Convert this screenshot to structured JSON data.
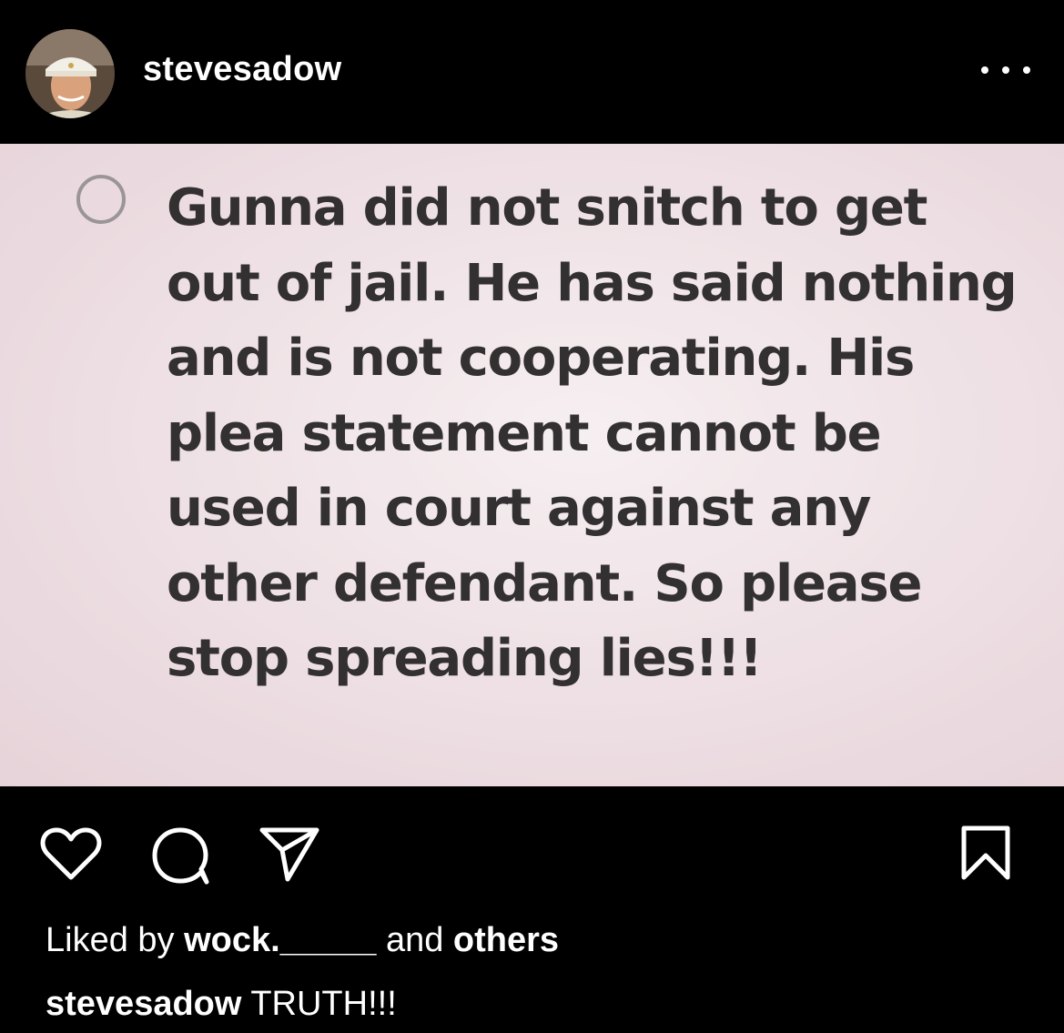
{
  "header": {
    "username": "stevesadow",
    "avatar_icon": "profile-photo",
    "more_icon": "more-horizontal-icon"
  },
  "post": {
    "note_lines": [
      "Gunna did not snitch to get",
      "out of jail. He has said nothing",
      "and is not cooperating. His",
      "plea statement cannot be",
      "used in court against any",
      "other defendant. So please",
      "stop spreading lies!!!"
    ],
    "background_color": "#efe2e6",
    "text_color": "#333032"
  },
  "actions": {
    "like_icon": "heart-icon",
    "comment_icon": "comment-icon",
    "share_icon": "send-icon",
    "save_icon": "bookmark-icon"
  },
  "likes": {
    "prefix": "Liked by",
    "user": "wock._____",
    "middle": "and",
    "suffix": "others"
  },
  "caption": {
    "username": "stevesadow",
    "text": "TRUTH!!!"
  }
}
